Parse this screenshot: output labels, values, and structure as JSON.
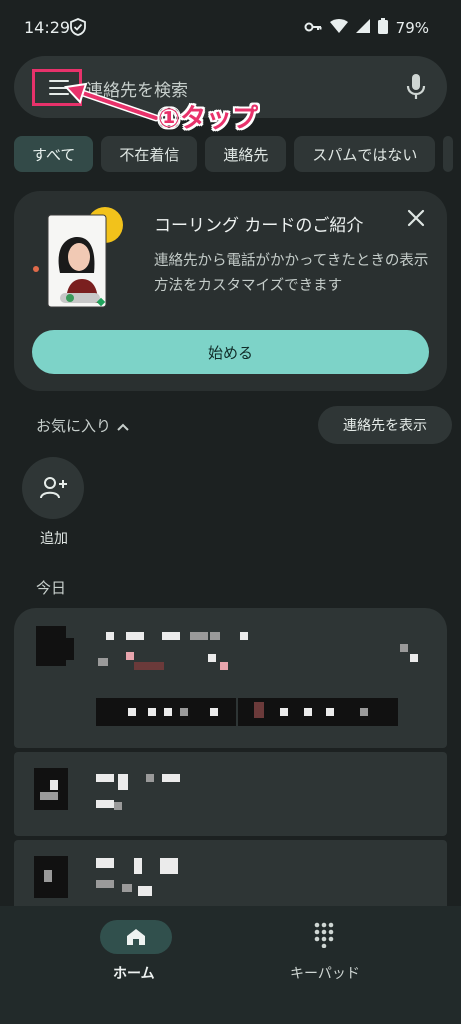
{
  "status_bar": {
    "time": "14:29",
    "battery": "79%"
  },
  "search": {
    "placeholder": "連絡先を検索"
  },
  "annotation": {
    "text": "①タップ",
    "color": "#e8326b"
  },
  "chips": [
    {
      "label": "すべて",
      "selected": true
    },
    {
      "label": "不在着信"
    },
    {
      "label": "連絡先"
    },
    {
      "label": "スパムではない"
    }
  ],
  "promo_card": {
    "title": "コーリング カードのご紹介",
    "body": "連絡先から電話がかかってきたときの表示方法をカスタマイズできます",
    "cta": "始める"
  },
  "favorites": {
    "label": "お気に入り",
    "show_contacts": "連絡先を表示",
    "add_label": "追加"
  },
  "recents": {
    "section_label": "今日"
  },
  "bottom_nav": {
    "home": "ホーム",
    "keypad": "キーパッド"
  },
  "colors": {
    "accent": "#7dd3c8",
    "background": "#1c2121",
    "surface": "#2f3636",
    "annotation": "#e8326b"
  }
}
